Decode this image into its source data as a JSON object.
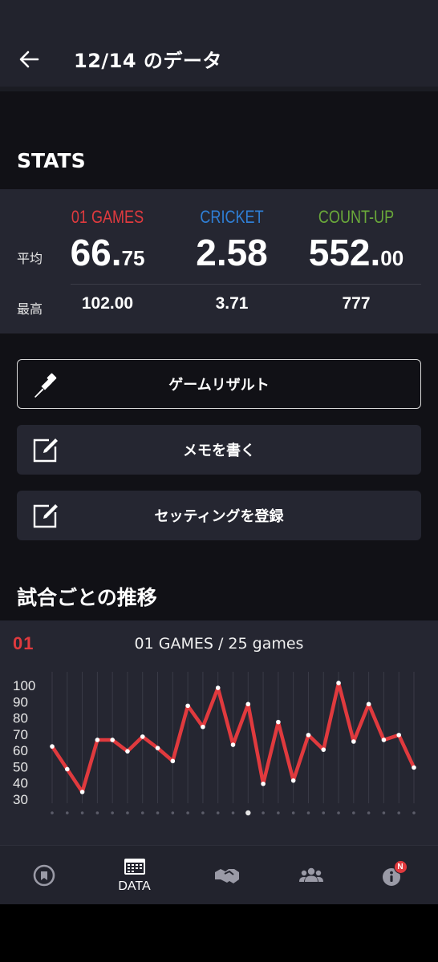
{
  "header": {
    "title": "12/14 のデータ"
  },
  "stats": {
    "section_title": "STATS",
    "row_avg_label": "平均",
    "row_best_label": "最高",
    "categories": [
      {
        "name": "01 GAMES",
        "color": "#e03a3e",
        "avg_int": "66",
        "avg_dec": "75",
        "best": "102.00"
      },
      {
        "name": "CRICKET",
        "color": "#2f7fd6",
        "avg_int": "2",
        "avg_dec": "58",
        "best": "3.71"
      },
      {
        "name": "COUNT-UP",
        "color": "#6aa93a",
        "avg_int": "552",
        "avg_dec": "00",
        "best": "777"
      }
    ]
  },
  "actions": {
    "game_result": "ゲームリザルト",
    "write_memo": "メモを書く",
    "register_setting": "セッティングを登録"
  },
  "trend": {
    "section_title": "試合ごとの推移",
    "badge": "01",
    "chart_title": "01 GAMES / 25 games"
  },
  "chart_data": {
    "type": "line",
    "title": "01 GAMES / 25 games",
    "x": [
      1,
      2,
      3,
      4,
      5,
      6,
      7,
      8,
      9,
      10,
      11,
      12,
      13,
      14,
      15,
      16,
      17,
      18,
      19,
      20,
      21,
      22,
      23,
      24,
      25
    ],
    "series": [
      {
        "values": [
          62,
          48,
          34,
          66,
          66,
          59,
          68,
          61,
          53,
          87,
          74,
          98,
          63,
          88,
          39,
          77,
          41,
          69,
          60,
          101,
          65,
          88,
          66,
          69,
          49
        ],
        "color": "#e03a3e"
      }
    ],
    "yticks": [
      100,
      90,
      80,
      70,
      60,
      50,
      40,
      30
    ],
    "ylim": [
      30,
      101
    ],
    "grid": "vertical",
    "selected_index": 13
  },
  "nav": {
    "items": [
      {
        "icon": "home-icon",
        "label": ""
      },
      {
        "icon": "calendar-icon",
        "label": "DATA"
      },
      {
        "icon": "handshake-icon",
        "label": ""
      },
      {
        "icon": "users-icon",
        "label": ""
      },
      {
        "icon": "info-icon",
        "label": ""
      }
    ],
    "badge": "N"
  }
}
